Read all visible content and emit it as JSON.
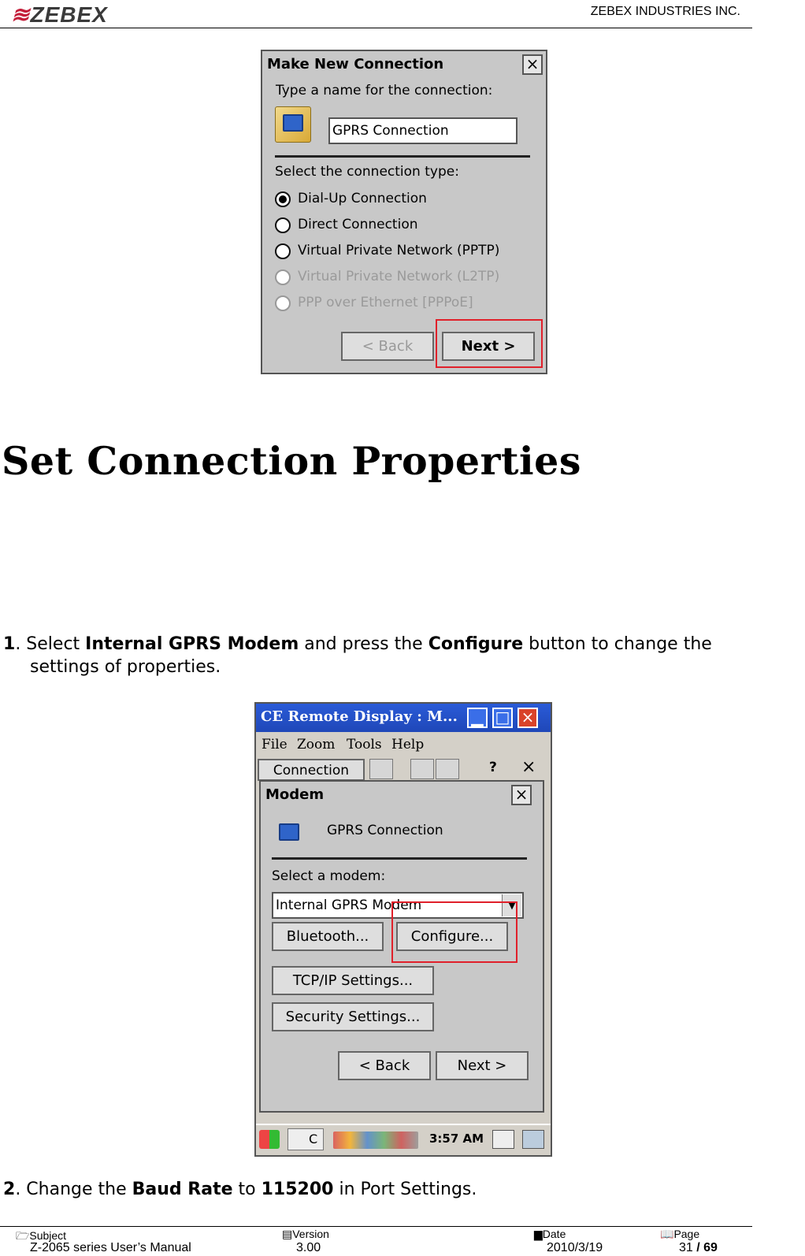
{
  "header": {
    "logo": "ZEBEX",
    "company": "ZEBEX INDUSTRIES INC."
  },
  "dialog1": {
    "title": "Make New Connection",
    "close": "×",
    "name_prompt": "Type a name for the connection:",
    "name_value": "GPRS Connection",
    "type_prompt": "Select the connection type:",
    "options": [
      {
        "label": "Dial-Up Connection",
        "selected": true,
        "enabled": true
      },
      {
        "label": "Direct Connection",
        "selected": false,
        "enabled": true
      },
      {
        "label": "Virtual Private Network (PPTP)",
        "selected": false,
        "enabled": true
      },
      {
        "label": "Virtual Private Network (L2TP)",
        "selected": false,
        "enabled": false
      },
      {
        "label": "PPP over Ethernet [PPPoE]",
        "selected": false,
        "enabled": false
      }
    ],
    "back": "< Back",
    "next": "Next >"
  },
  "section_title": "Set Connection Properties",
  "step1": {
    "num": "1",
    "t1": ". Select ",
    "b1": "Internal GPRS Modem",
    "t2": " and press the ",
    "b2": "Configure",
    "t3": " button to change the",
    "line2": "settings of properties."
  },
  "remote": {
    "title": "CE Remote Display : M...",
    "menu": [
      "File",
      "Zoom",
      "Tools",
      "Help"
    ],
    "toolbar_label": "Connection",
    "q": "?",
    "x": "×"
  },
  "dialog2": {
    "title": "Modem",
    "close": "×",
    "conn_name": "GPRS Connection",
    "modem_prompt": "Select a modem:",
    "modem_value": "Internal GPRS Modem",
    "buttons": [
      "Bluetooth...",
      "Configure...",
      "TCP/IP Settings...",
      "Security Settings..."
    ],
    "back": "< Back",
    "next": "Next >"
  },
  "taskbar": {
    "clock": "3:57 AM",
    "task_label": "C"
  },
  "step2": {
    "num": "2",
    "t1": ". Change the ",
    "b1": "Baud Rate",
    "t2": " to ",
    "b2": "115200",
    "t3": " in Port Settings."
  },
  "footer": {
    "subject_label": "Subject",
    "subject": "Z-2065 series User’s Manual",
    "version_label": "Version",
    "version": "3.00",
    "date_label": "Date",
    "date": "2010/3/19",
    "page_label": "Page",
    "page_current": "31",
    "page_sep": " / ",
    "page_total": "69"
  }
}
